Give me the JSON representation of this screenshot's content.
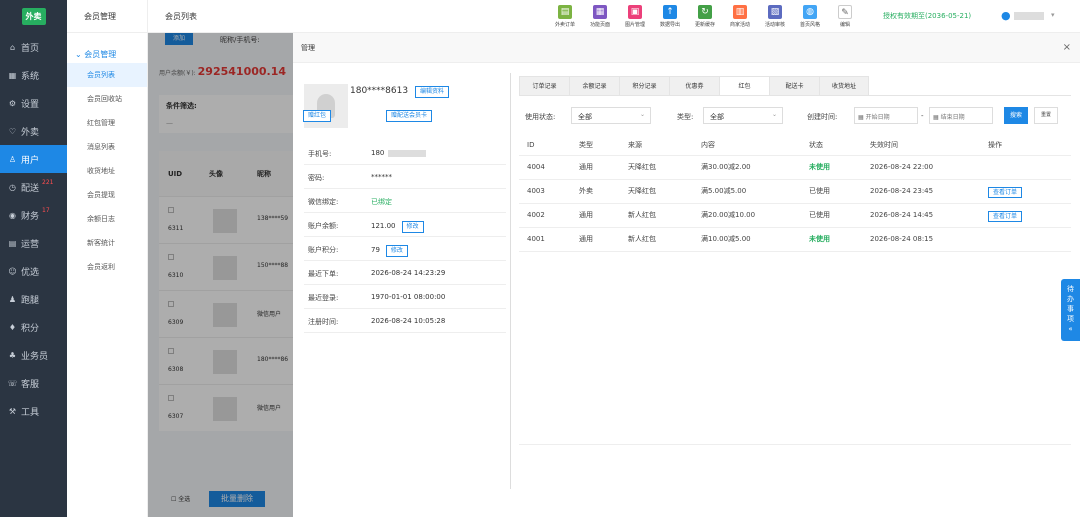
{
  "sidebar": {
    "logo": "外卖",
    "items": [
      {
        "label": "首页",
        "icon": "home-icon",
        "glyph": "⌂"
      },
      {
        "label": "系统",
        "icon": "system-icon",
        "glyph": "▦"
      },
      {
        "label": "设置",
        "icon": "settings-icon",
        "glyph": "⚙"
      },
      {
        "label": "外卖",
        "icon": "takeout-icon",
        "glyph": "♡"
      },
      {
        "label": "用户",
        "icon": "user-icon",
        "glyph": "♙"
      },
      {
        "label": "配送",
        "icon": "delivery-icon",
        "glyph": "◷",
        "badge": "221"
      },
      {
        "label": "财务",
        "icon": "finance-icon",
        "glyph": "◉",
        "badge": "17"
      },
      {
        "label": "运营",
        "icon": "operation-icon",
        "glyph": "▤"
      },
      {
        "label": "优选",
        "icon": "select-icon",
        "glyph": "☺"
      },
      {
        "label": "跑腿",
        "icon": "errand-icon",
        "glyph": "♟"
      },
      {
        "label": "积分",
        "icon": "points-icon",
        "glyph": "♦"
      },
      {
        "label": "业务员",
        "icon": "salesman-icon",
        "glyph": "♣"
      },
      {
        "label": "客服",
        "icon": "service-icon",
        "glyph": "☏"
      },
      {
        "label": "工具",
        "icon": "tools-icon",
        "glyph": "⚒"
      }
    ]
  },
  "submenu": {
    "header": "会员管理",
    "group": "会员管理",
    "items": [
      "会员列表",
      "会员回收站",
      "红包管理",
      "消息列表",
      "收货地址",
      "会员提现",
      "余额日志",
      "新客统计",
      "会员返利"
    ]
  },
  "topbar": {
    "title": "会员列表",
    "tools": [
      {
        "label": "外卖订单",
        "color": "#7cb342",
        "glyph": "▤"
      },
      {
        "label": "功能页面",
        "color": "#7e57c2",
        "glyph": "▦"
      },
      {
        "label": "图片管理",
        "color": "#ec407a",
        "glyph": "▣"
      },
      {
        "label": "数据导出",
        "color": "#1e88e5",
        "glyph": "↑"
      },
      {
        "label": "更新缓存",
        "color": "#43a047",
        "glyph": "↻"
      },
      {
        "label": "商家活动",
        "color": "#ff7043",
        "glyph": "▥"
      },
      {
        "label": "活动审核",
        "color": "#5c6bc0",
        "glyph": "▧"
      },
      {
        "label": "首页风格",
        "color": "#42a5f5",
        "glyph": "◍"
      },
      {
        "label": "编辑",
        "color": "#ffffff",
        "glyph": "✎"
      }
    ],
    "license": "授权有效期至(2036-05-21)"
  },
  "background": {
    "add_label": "添加",
    "search_label": "昵称/手机号:",
    "balance_label": "用户余额(￥):",
    "balance_value": "292541000.14",
    "filter_title": "条件筛选:",
    "columns": [
      "UID",
      "头像",
      "昵称"
    ],
    "rows": [
      {
        "uid": "6311",
        "nick": "138****59"
      },
      {
        "uid": "6310",
        "nick": "150****88"
      },
      {
        "uid": "6309",
        "nick": "微信用户"
      },
      {
        "uid": "6308",
        "nick": "180****86"
      },
      {
        "uid": "6307",
        "nick": "微信用户"
      }
    ],
    "select_all": "全选",
    "batch_delete": "批量删除"
  },
  "modal": {
    "title": "管理",
    "close": "×",
    "profile": {
      "phone": "180****8613",
      "edit_btn": "编辑资料",
      "give_redpacket_btn": "赠红包",
      "give_card_btn": "赠配送会员卡"
    },
    "info": [
      {
        "key": "手机号:",
        "value": "180"
      },
      {
        "key": "密码:",
        "value": "******"
      },
      {
        "key": "微信绑定:",
        "value": "已绑定"
      },
      {
        "key": "账户余额:",
        "value": "121.00",
        "btn": "修改"
      },
      {
        "key": "账户积分:",
        "value": "79",
        "btn": "修改"
      },
      {
        "key": "最近下单:",
        "value": "2026-08-24 14:23:29"
      },
      {
        "key": "最近登录:",
        "value": "1970-01-01 08:00:00"
      },
      {
        "key": "注册时间:",
        "value": "2026-08-24 10:05:28"
      }
    ],
    "tabs": [
      "订单记录",
      "余额记录",
      "积分记录",
      "优惠券",
      "红包",
      "配送卡",
      "收货地址"
    ],
    "active_tab": "红包",
    "filters": {
      "status_label": "使用状态:",
      "status_value": "全部",
      "type_label": "类型:",
      "type_value": "全部",
      "time_label": "创建时间:",
      "start_placeholder": "开始日期",
      "range_sep": "-",
      "end_placeholder": "结束日期",
      "search_btn": "搜索",
      "reset_btn": "重置"
    },
    "table": {
      "columns": [
        "ID",
        "类型",
        "来源",
        "内容",
        "状态",
        "失效时间",
        "操作"
      ],
      "rows": [
        {
          "id": "4004",
          "type": "通用",
          "source": "天降红包",
          "content": "满30.00减2.00",
          "status": "未使用",
          "expire": "2026-08-24 22:00",
          "action": ""
        },
        {
          "id": "4003",
          "type": "外卖",
          "source": "天降红包",
          "content": "满5.00减5.00",
          "status": "已使用",
          "expire": "2026-08-24 23:45",
          "action": "查看订单"
        },
        {
          "id": "4002",
          "type": "通用",
          "source": "新人红包",
          "content": "满20.00减10.00",
          "status": "已使用",
          "expire": "2026-08-24 14:45",
          "action": "查看订单"
        },
        {
          "id": "4001",
          "type": "通用",
          "source": "新人红包",
          "content": "满10.00减5.00",
          "status": "未使用",
          "expire": "2026-08-24 08:15",
          "action": ""
        }
      ]
    }
  },
  "todo_label": "待办事项"
}
